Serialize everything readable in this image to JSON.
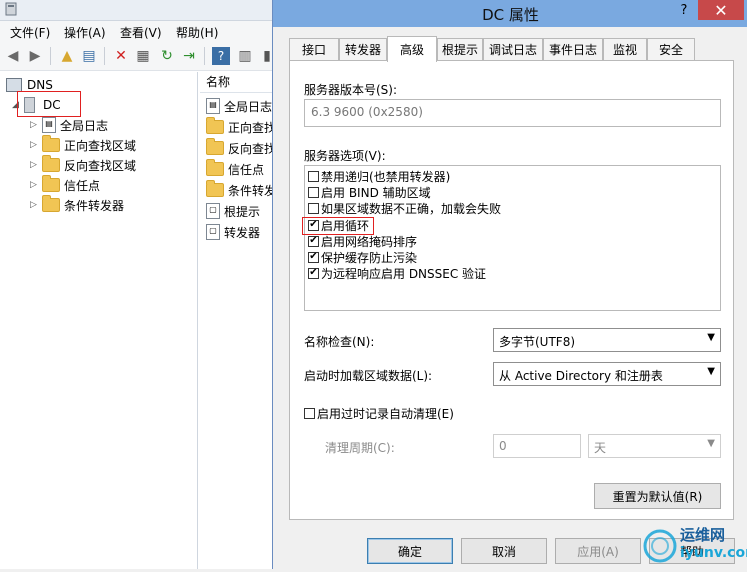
{
  "bg_window": {
    "menu": [
      "文件(F)",
      "操作(A)",
      "查看(V)",
      "帮助(H)"
    ],
    "tree": {
      "root": "DNS",
      "server": "DC",
      "children": [
        "全局日志",
        "正向查找区域",
        "反向查找区域",
        "信任点",
        "条件转发器"
      ]
    },
    "list": {
      "header": "名称",
      "rows": [
        "全局日志",
        "正向查找",
        "反向查找",
        "信任点",
        "条件转发",
        "根提示",
        "转发器"
      ]
    }
  },
  "dialog": {
    "title": "DC 属性",
    "help_label": "?",
    "close_label": "✕",
    "tabs": [
      "接口",
      "转发器",
      "高级",
      "根提示",
      "调试日志",
      "事件日志",
      "监视",
      "安全"
    ],
    "active_tab": "高级",
    "version_label": "服务器版本号(S):",
    "version_value": "6.3 9600 (0x2580)",
    "options_label": "服务器选项(V):",
    "options": [
      {
        "label": "禁用递归(也禁用转发器)",
        "checked": false
      },
      {
        "label": "启用 BIND 辅助区域",
        "checked": false
      },
      {
        "label": "如果区域数据不正确，加载会失败",
        "checked": false
      },
      {
        "label": "启用循环",
        "checked": true
      },
      {
        "label": "启用网络掩码排序",
        "checked": true
      },
      {
        "label": "保护缓存防止污染",
        "checked": true
      },
      {
        "label": "为远程响应启用 DNSSEC 验证",
        "checked": true
      }
    ],
    "name_check_label": "名称检查(N):",
    "name_check_value": "多字节(UTF8)",
    "load_zone_label": "启动时加载区域数据(L):",
    "load_zone_value": "从 Active Directory 和注册表",
    "scavenging_label": "启用过时记录自动清理(E)",
    "scavenging_checked": false,
    "cleanup_label": "清理周期(C):",
    "cleanup_value": "0",
    "cleanup_unit": "天",
    "reset_label": "重置为默认值(R)",
    "ok_label": "确定",
    "cancel_label": "取消",
    "apply_label": "应用(A)",
    "help_button_label": "帮助"
  },
  "watermark": {
    "line1": "运维网",
    "line2": "iyunv.com"
  }
}
